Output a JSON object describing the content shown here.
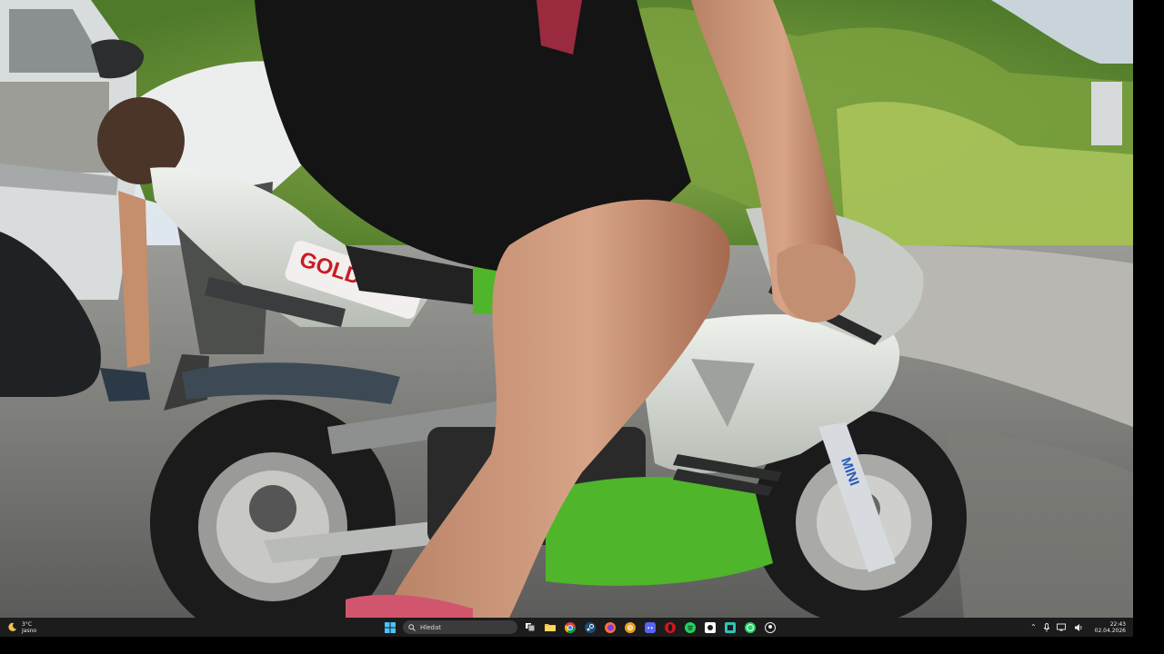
{
  "scene": {
    "description_hidden": "",
    "fairing_brand": "GOLD",
    "fork_sticker": "MINI"
  },
  "taskbar": {
    "weather": {
      "temperature": "3°C",
      "condition": "Jasno"
    },
    "search": {
      "placeholder": "Hledat"
    },
    "pinned_apps": [
      {
        "name": "task-view"
      },
      {
        "name": "file-explorer"
      },
      {
        "name": "chrome"
      },
      {
        "name": "steam"
      },
      {
        "name": "firefox"
      },
      {
        "name": "chrome-canary"
      },
      {
        "name": "discord"
      },
      {
        "name": "opera"
      },
      {
        "name": "spotify"
      },
      {
        "name": "steam-alt"
      },
      {
        "name": "media-app"
      },
      {
        "name": "whatsapp"
      },
      {
        "name": "github"
      }
    ],
    "clock": {
      "time": "22:43",
      "date": "02.04.2026"
    }
  },
  "colors": {
    "taskbar_bg": "#1c1c1c",
    "bike_green": "#4fb52a",
    "bike_silver": "#d9ddd8"
  }
}
